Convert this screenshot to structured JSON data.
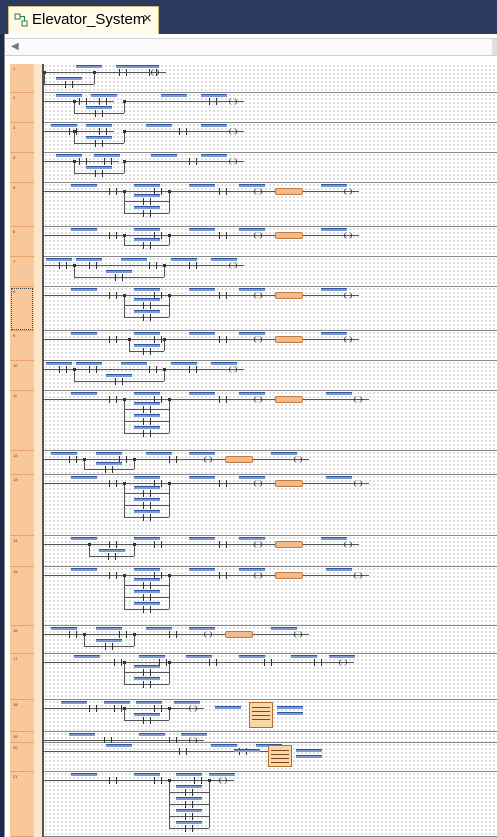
{
  "window": {
    "tab_title": "Elevator_System",
    "tab_close_glyph": "×",
    "tab_icon": "ladder-diagram-icon",
    "accent_color": "#f8c79a"
  },
  "editor": {
    "scroll_left_glyph": "◀",
    "rungs": [
      "1",
      "2",
      "3",
      "4",
      "5",
      "6",
      "7",
      "8",
      "9",
      "10",
      "11",
      "12",
      "13",
      "14",
      "15",
      "16",
      "17",
      "18",
      "19",
      "20",
      "21"
    ],
    "selected_rung": "8"
  }
}
